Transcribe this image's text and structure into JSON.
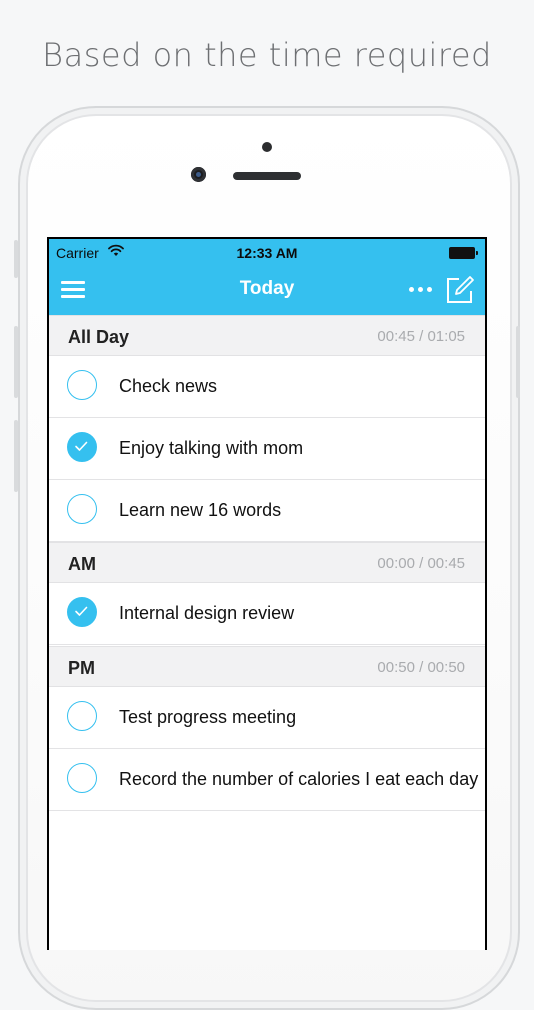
{
  "caption": "Based on the time required",
  "status_bar": {
    "carrier": "Carrier",
    "time": "12:33 AM"
  },
  "nav": {
    "title": "Today",
    "menu_icon": "hamburger-menu-icon",
    "more_icon": "more-dots-icon",
    "compose_icon": "compose-icon"
  },
  "colors": {
    "accent": "#35c0ef",
    "section_bg": "#f2f2f3",
    "muted_text": "#a9abae"
  },
  "sections": [
    {
      "title": "All Day",
      "time": "00:45 / 01:05",
      "tasks": [
        {
          "label": "Check news",
          "done": false
        },
        {
          "label": "Enjoy talking with mom",
          "done": true
        },
        {
          "label": "Learn new 16 words",
          "done": false
        }
      ]
    },
    {
      "title": "AM",
      "time": "00:00 / 00:45",
      "tasks": [
        {
          "label": "Internal design review",
          "done": true
        }
      ]
    },
    {
      "title": "PM",
      "time": "00:50 / 00:50",
      "tasks": [
        {
          "label": "Test progress meeting",
          "done": false
        },
        {
          "label": "Record the number of calories I eat each day",
          "done": false
        }
      ]
    }
  ]
}
